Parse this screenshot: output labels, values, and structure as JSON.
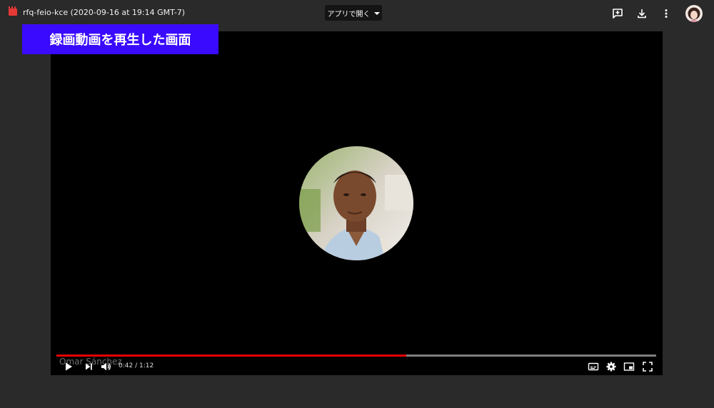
{
  "header": {
    "file_title": "rfq-feio-kce (2020-09-16 at 19:14 GMT-7)",
    "open_with_label": "アプリで開く"
  },
  "overlay": {
    "label": "録画動画を再生した画面",
    "color": "#3a0aff"
  },
  "player": {
    "speaker_name": "Omar Sánchez",
    "current_time": "0:42",
    "duration": "1:12",
    "time_display": "0:42 / 1:12",
    "progress_fraction": 0.5833,
    "progress_color": "#e60000"
  },
  "icons": {
    "file": "video-file-icon",
    "add_comment": "add-comment-icon",
    "download": "download-icon",
    "more": "more-vert-icon",
    "play": "play-icon",
    "next": "next-icon",
    "volume": "volume-icon",
    "subtitles": "subtitles-icon",
    "settings": "gear-icon",
    "miniplayer": "miniplayer-icon",
    "fullscreen": "fullscreen-icon"
  }
}
